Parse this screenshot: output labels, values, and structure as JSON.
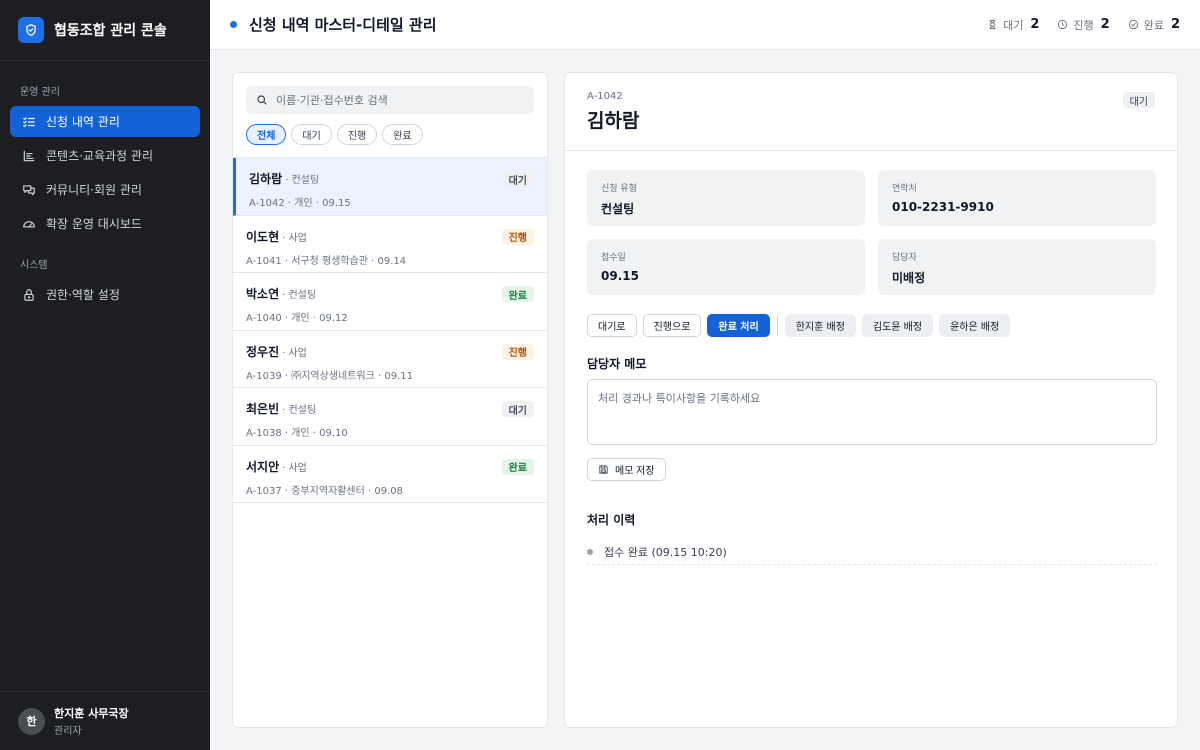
{
  "app": {
    "title": "협동조합 관리 콘솔"
  },
  "sidebar": {
    "sections": [
      {
        "label": "운영 관리"
      },
      {
        "label": "시스템"
      }
    ],
    "items": [
      {
        "label": "신청 내역 관리",
        "icon": "checklist-icon"
      },
      {
        "label": "콘텐츠·교육과정 관리",
        "icon": "bars-icon"
      },
      {
        "label": "커뮤니티·회원 관리",
        "icon": "chat-icon"
      },
      {
        "label": "확장 운영 대시보드",
        "icon": "gauge-icon"
      },
      {
        "label": "권한·역할 설정",
        "icon": "lock-icon"
      }
    ],
    "user": {
      "initial": "한",
      "name": "한지훈 사무국장",
      "role": "관리자"
    }
  },
  "header": {
    "title": "신청 내역 마스터-디테일 관리",
    "stats": [
      {
        "label": "대기",
        "count": "2",
        "icon": "hourglass-icon"
      },
      {
        "label": "진행",
        "count": "2",
        "icon": "clock-icon"
      },
      {
        "label": "완료",
        "count": "2",
        "icon": "check-circle-icon"
      }
    ]
  },
  "list": {
    "search_placeholder": "이름·기관·접수번호 검색",
    "filters": [
      "전체",
      "대기",
      "진행",
      "완료"
    ],
    "items": [
      {
        "name": "김하람",
        "type": "· 컨설팅",
        "sub": "A-1042 · 개인 · 09.15",
        "status": "대기"
      },
      {
        "name": "이도현",
        "type": "· 사업",
        "sub": "A-1041 · 서구청 평생학습관 · 09.14",
        "status": "진행"
      },
      {
        "name": "박소연",
        "type": "· 컨설팅",
        "sub": "A-1040 · 개인 · 09.12",
        "status": "완료"
      },
      {
        "name": "정우진",
        "type": "· 사업",
        "sub": "A-1039 · ㈜지역상생네트워크 · 09.11",
        "status": "진행"
      },
      {
        "name": "최은빈",
        "type": "· 컨설팅",
        "sub": "A-1038 · 개인 · 09.10",
        "status": "대기"
      },
      {
        "name": "서지안",
        "type": "· 사업",
        "sub": "A-1037 · 중부지역자활센터 · 09.08",
        "status": "완료"
      }
    ]
  },
  "detail": {
    "id": "A-1042",
    "name": "김하람",
    "status": "대기",
    "fields": [
      {
        "label": "신청 유형",
        "value": "컨설팅"
      },
      {
        "label": "연락처",
        "value": "010-2231-9910"
      },
      {
        "label": "접수일",
        "value": "09.15"
      },
      {
        "label": "담당자",
        "value": "미배정"
      }
    ],
    "actions": {
      "to_wait": "대기로",
      "to_progress": "진행으로",
      "complete": "완료 처리",
      "assign_1": "한지훈 배정",
      "assign_2": "김도윤 배정",
      "assign_3": "윤하은 배정"
    },
    "memo_title": "담당자 메모",
    "memo_placeholder": "처리 경과나 특이사항을 기록하세요",
    "memo_save": "메모 저장",
    "history_title": "처리 이력",
    "history": [
      {
        "text": "접수 완료 (09.15 10:20)"
      }
    ]
  },
  "colors": {
    "accent": "#1362d8",
    "sidebar_bg": "#1d1e22",
    "wait": "#4b5563",
    "progress": "#b45309",
    "done": "#15803d"
  }
}
